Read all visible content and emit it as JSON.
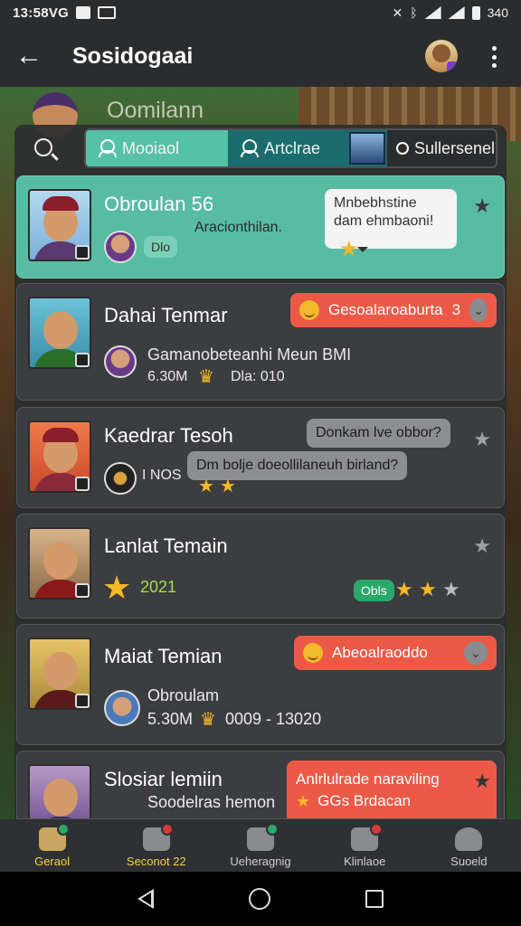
{
  "status_bar": {
    "time": "13:58VG",
    "right_text": "340"
  },
  "app_bar": {
    "title": "Sosidogaai"
  },
  "scene": {
    "title": "Oomilann"
  },
  "filters": [
    {
      "label": "Mooiaol"
    },
    {
      "label": "Artclrae"
    },
    {
      "label": "Sullersenel"
    }
  ],
  "cards": [
    {
      "name": "Obroulan 56",
      "subtitle": "Aracionthilan.",
      "tag": "Dlo",
      "bubble": "Mnbebhstine\ndam ehmbaoni!"
    },
    {
      "name": "Dahai Tenmar",
      "pill": "Gesoalaroaburta",
      "pill_suffix": "3",
      "line1": "Gamanobeteanhi Meun BMI",
      "line2": "6.30M",
      "line2b": "Dla: 010"
    },
    {
      "name": "Kaedrar Tesoh",
      "bubble1": "Donkam lve obbor?",
      "bubble2": "Dm bolje doeollilaneuh birland?",
      "line1": "I NOS"
    },
    {
      "name": "Lanlat Temain",
      "value": "2021",
      "tag": "Obls"
    },
    {
      "name": "Maiat Temian",
      "pill": "Abeoalraoddo",
      "line1": "Obroulam",
      "line2": "5.30M",
      "line2b": "0009 - 13020"
    },
    {
      "name": "Slosiar lemiin",
      "line1": "Soodelras hemon",
      "pill_line1": "Anlrlulrade naraviling",
      "pill_line2": "GGs Brdacan"
    }
  ],
  "bottom_nav": [
    {
      "label": "Geraol"
    },
    {
      "label": "Seconot 22"
    },
    {
      "label": "Ueheragnig"
    },
    {
      "label": "Klinlaoe"
    },
    {
      "label": "Suoeld"
    }
  ],
  "colors": {
    "accent": "#57bca2",
    "pill": "#ec5a47",
    "star": "#f4b929",
    "panel": "#3c3d40"
  },
  "icons": [
    "back-arrow-icon",
    "more-vert-icon",
    "search-icon",
    "star-icon",
    "chevron-down-icon"
  ]
}
